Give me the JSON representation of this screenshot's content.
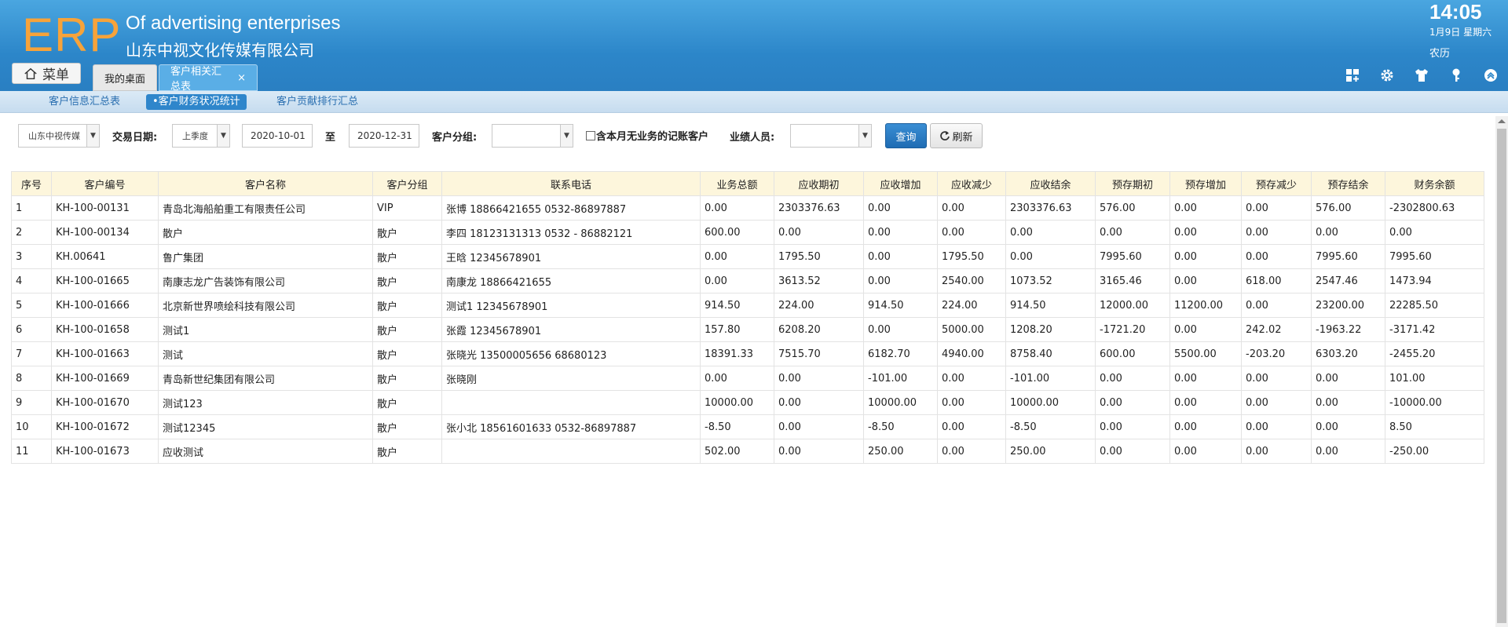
{
  "header": {
    "logo": "ERP",
    "brand_en": "Of advertising enterprises",
    "brand_cn": "山东中视文化传媒有限公司",
    "time": "14:05",
    "date": "1月9日 星期六",
    "lunar": "农历",
    "menu_label": "菜单",
    "tabs": [
      {
        "label": "我的桌面"
      },
      {
        "label": "客户相关汇总表",
        "close": "×"
      }
    ],
    "tool_icons": [
      "grid-add-icon",
      "gear-icon",
      "tshirt-icon",
      "key-icon",
      "chevron-up-circle-icon"
    ]
  },
  "subnav": {
    "items": [
      {
        "label": "客户信息汇总表"
      },
      {
        "label": "•客户财务状况统计"
      },
      {
        "label": "客户贡献排行汇总"
      }
    ]
  },
  "filters": {
    "company": "山东中视传媒",
    "date_label": "交易日期:",
    "period": "上季度",
    "start_date": "2020-10-01",
    "to_label": "至",
    "end_date": "2020-12-31",
    "group_label": "客户分组:",
    "group_value": "",
    "checkbox_label": "含本月无业务的记账客户",
    "staff_label": "业绩人员:",
    "staff_value": "",
    "query_label": "查询",
    "refresh_label": "刷新"
  },
  "table": {
    "columns": [
      "序号",
      "客户编号",
      "客户名称",
      "客户分组",
      "联系电话",
      "业务总额",
      "应收期初",
      "应收增加",
      "应收减少",
      "应收结余",
      "预存期初",
      "预存增加",
      "预存减少",
      "预存结余",
      "财务余额"
    ],
    "rows": [
      [
        "1",
        "KH-100-00131",
        "青岛北海船舶重工有限责任公司",
        "VIP",
        "张博 18866421655 0532-86897887",
        "0.00",
        "2303376.63",
        "0.00",
        "0.00",
        "2303376.63",
        "576.00",
        "0.00",
        "0.00",
        "576.00",
        "-2302800.63"
      ],
      [
        "2",
        "KH-100-00134",
        "散户",
        "散户",
        "李四 18123131313 0532 - 86882121",
        "600.00",
        "0.00",
        "0.00",
        "0.00",
        "0.00",
        "0.00",
        "0.00",
        "0.00",
        "0.00",
        "0.00"
      ],
      [
        "3",
        "KH.00641",
        "鲁广集团",
        "散户",
        "王晗 12345678901",
        "0.00",
        "1795.50",
        "0.00",
        "1795.50",
        "0.00",
        "7995.60",
        "0.00",
        "0.00",
        "7995.60",
        "7995.60"
      ],
      [
        "4",
        "KH-100-01665",
        "南康志龙广告装饰有限公司",
        "散户",
        "南康龙 18866421655",
        "0.00",
        "3613.52",
        "0.00",
        "2540.00",
        "1073.52",
        "3165.46",
        "0.00",
        "618.00",
        "2547.46",
        "1473.94"
      ],
      [
        "5",
        "KH-100-01666",
        "北京新世界喷绘科技有限公司",
        "散户",
        "测试1 12345678901",
        "914.50",
        "224.00",
        "914.50",
        "224.00",
        "914.50",
        "12000.00",
        "11200.00",
        "0.00",
        "23200.00",
        "22285.50"
      ],
      [
        "6",
        "KH-100-01658",
        "测试1",
        "散户",
        "张霞 12345678901",
        "157.80",
        "6208.20",
        "0.00",
        "5000.00",
        "1208.20",
        "-1721.20",
        "0.00",
        "242.02",
        "-1963.22",
        "-3171.42"
      ],
      [
        "7",
        "KH-100-01663",
        "测试",
        "散户",
        "张晓光 13500005656 68680123",
        "18391.33",
        "7515.70",
        "6182.70",
        "4940.00",
        "8758.40",
        "600.00",
        "5500.00",
        "-203.20",
        "6303.20",
        "-2455.20"
      ],
      [
        "8",
        "KH-100-01669",
        "青岛新世纪集团有限公司",
        "散户",
        "张晓刚",
        "0.00",
        "0.00",
        "-101.00",
        "0.00",
        "-101.00",
        "0.00",
        "0.00",
        "0.00",
        "0.00",
        "101.00"
      ],
      [
        "9",
        "KH-100-01670",
        "测试123",
        "散户",
        "",
        "10000.00",
        "0.00",
        "10000.00",
        "0.00",
        "10000.00",
        "0.00",
        "0.00",
        "0.00",
        "0.00",
        "-10000.00"
      ],
      [
        "10",
        "KH-100-01672",
        "测试12345",
        "散户",
        "张小北 18561601633 0532-86897887",
        "-8.50",
        "0.00",
        "-8.50",
        "0.00",
        "-8.50",
        "0.00",
        "0.00",
        "0.00",
        "0.00",
        "8.50"
      ],
      [
        "11",
        "KH-100-01673",
        "应收测试",
        "散户",
        "",
        "502.00",
        "0.00",
        "250.00",
        "0.00",
        "250.00",
        "0.00",
        "0.00",
        "0.00",
        "0.00",
        "-250.00"
      ]
    ]
  }
}
